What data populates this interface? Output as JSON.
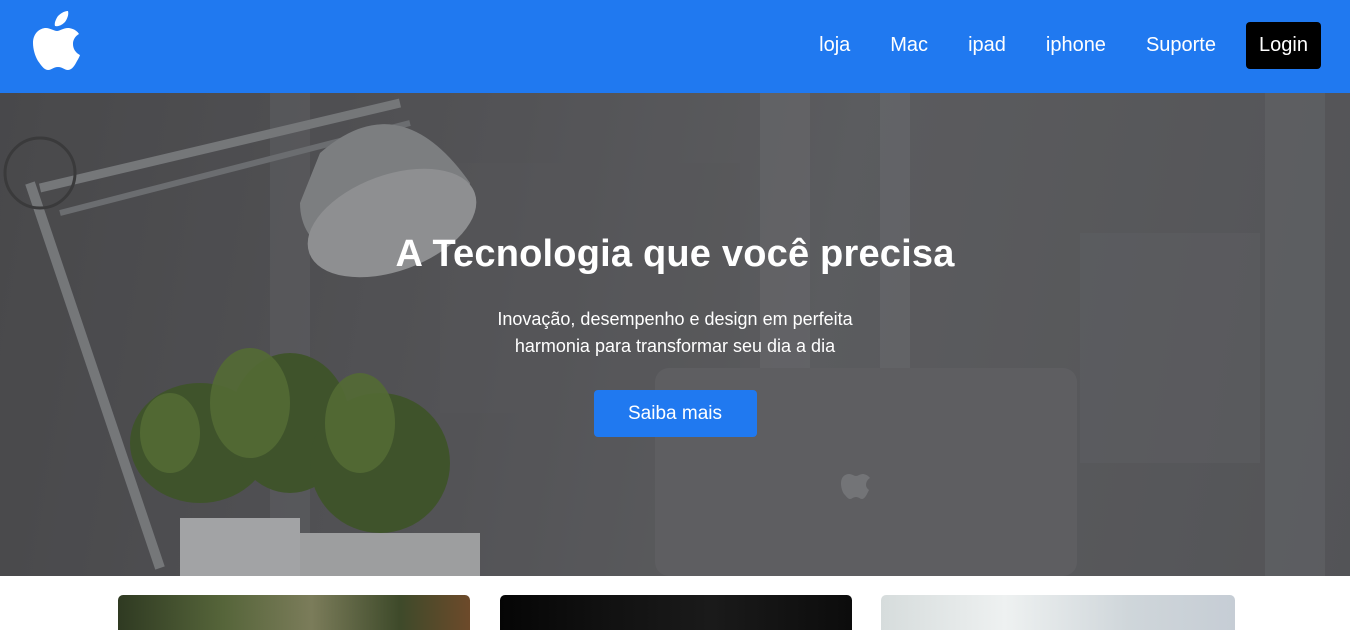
{
  "navbar": {
    "logo_icon": "apple-logo-icon",
    "links": [
      {
        "label": "loja"
      },
      {
        "label": "Mac"
      },
      {
        "label": "ipad"
      },
      {
        "label": "iphone"
      },
      {
        "label": "Suporte"
      }
    ],
    "login_label": "Login",
    "background_color": "#2079f0"
  },
  "hero": {
    "title": "A Tecnologia que você precisa",
    "subtitle": "Inovação, desempenho e design em perfeita harmonia para transformar seu dia a dia",
    "cta_label": "Saiba mais",
    "background_image": "desk-lamp-plants-laptop-photo"
  },
  "cards": [
    {
      "image": "plant-photo"
    },
    {
      "image": "dark-device-photo"
    },
    {
      "image": "light-device-photo"
    }
  ],
  "colors": {
    "accent": "#2079f0",
    "login_button": "#000000"
  }
}
